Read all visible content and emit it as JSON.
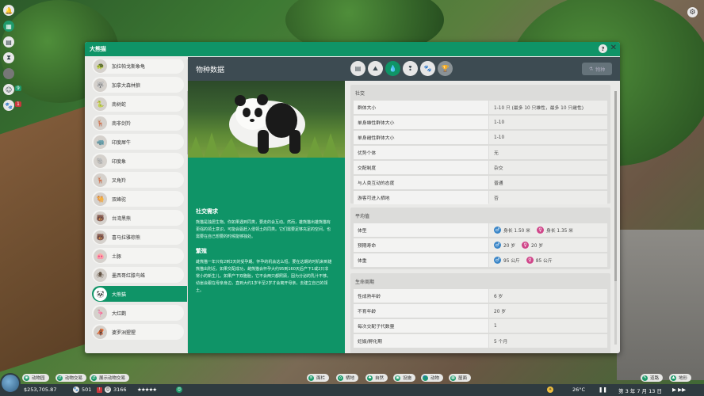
{
  "left_icons": [
    {
      "icon": "notification-icon",
      "count": ""
    },
    {
      "icon": "calendar-icon",
      "count": ""
    },
    {
      "icon": "grid-icon",
      "count": ""
    },
    {
      "icon": "hourglass-icon",
      "count": ""
    },
    {
      "icon": "empty-icon",
      "count": ""
    },
    {
      "icon": "guest-icon",
      "count": "9"
    },
    {
      "icon": "paw-icon",
      "count": "1"
    }
  ],
  "window": {
    "title": "大熊猫",
    "help": "?",
    "close": "✕"
  },
  "sidebar": {
    "items": [
      {
        "label": "加拉帕戈斯象龟",
        "icon": "🐢"
      },
      {
        "label": "加拿大森林狼",
        "icon": "🐺"
      },
      {
        "label": "南树蛇",
        "icon": "🐍"
      },
      {
        "label": "南非剑羚",
        "icon": "🦌"
      },
      {
        "label": "印度犀牛",
        "icon": "🦏"
      },
      {
        "label": "印度象",
        "icon": "🐘"
      },
      {
        "label": "叉角羚",
        "icon": "🦌"
      },
      {
        "label": "双峰驼",
        "icon": "🐫"
      },
      {
        "label": "台湾黑熊",
        "icon": "🐻"
      },
      {
        "label": "喜马拉雅棕熊",
        "icon": "🐻"
      },
      {
        "label": "土豚",
        "icon": "🐽"
      },
      {
        "label": "墨西哥红膝鸟蛛",
        "icon": "🕷"
      },
      {
        "label": "大熊猫",
        "icon": "🐼",
        "selected": true
      },
      {
        "label": "大红鹳",
        "icon": "🦩"
      },
      {
        "label": "婆罗洲猩猩",
        "icon": "🦧"
      }
    ]
  },
  "header": {
    "title": "物种数据",
    "tabs": [
      {
        "icon": "document-icon",
        "glyph": "▤"
      },
      {
        "icon": "terrain-icon",
        "glyph": "⛰"
      },
      {
        "icon": "water-drop-icon",
        "glyph": "💧",
        "active": true
      },
      {
        "icon": "social-icon",
        "glyph": "❢"
      },
      {
        "icon": "paw-icon",
        "glyph": "🐾"
      },
      {
        "icon": "trophy-icon",
        "glyph": "🏆",
        "dim": true
      }
    ],
    "right_button": "物种"
  },
  "description": {
    "social_heading": "社交需求",
    "social_text": "熊猫是独居生物。你如果遇到同类，要走的会互动。然而，雄熊猫出雄熊猫有更强的领土意识，可能会驱赶入侵领土的同类。它们需要足够充足的空间，也需要在自己想要的时候能够独处。",
    "breeding_heading": "繁殖",
    "breeding_text": "雌熊猫一年只有2到3天的受孕期。怀孕的机会这么短，要在这期的时机来到雄熊猫出附近。如果交配成功，雌熊猫会怀孕大约95到160天后产下1或2只非常小的新生儿。如果产下双胞胎，它不会两只都照顾，因为分泌的乳汁不够。幼崽会跟在母亲身边，直到大约1岁半至2岁才会离开母亲，去建立自己的领土。"
  },
  "social": {
    "title": "社交",
    "rows": [
      {
        "k": "群体大小",
        "v": "1-10 只 (最多 10 只雄性，最多 10 只雌性)"
      },
      {
        "k": "单身雄性群体大小",
        "v": "1-10"
      },
      {
        "k": "单身雌性群体大小",
        "v": "1-10"
      },
      {
        "k": "优势个体",
        "v": "无"
      },
      {
        "k": "交配制度",
        "v": "杂交"
      },
      {
        "k": "与人类互动的态度",
        "v": "普通"
      },
      {
        "k": "游客可进入栖地",
        "v": "否"
      }
    ]
  },
  "average": {
    "title": "平均值",
    "rows": [
      {
        "k": "体型",
        "male": "身长 1.50 米",
        "female": "身长 1.35 米"
      },
      {
        "k": "预期寿命",
        "male": "20 岁",
        "female": "20 岁"
      },
      {
        "k": "体重",
        "male": "95 公斤",
        "female": "85 公斤"
      }
    ]
  },
  "lifecycle": {
    "title": "生命周期",
    "rows": [
      {
        "k": "性成熟年龄",
        "v": "6 岁"
      },
      {
        "k": "不育年龄",
        "v": "20 岁"
      },
      {
        "k": "每次交配子代数量",
        "v": "1"
      },
      {
        "k": "妊娠/孵化期",
        "v": "5 个月"
      }
    ]
  },
  "topbar": {
    "left": [
      "动物园",
      "动物交易",
      "展示动物交易"
    ],
    "right": [
      "面栏",
      "栖地",
      "自然",
      "设施",
      "动物",
      "屋面"
    ],
    "far_right": [
      "道路",
      "地形"
    ]
  },
  "bottombar": {
    "money": "$253,705.87",
    "animals": "501",
    "guests": "3166",
    "stars": "★★★★★",
    "temperature": "26°C",
    "date": "第 3 年 7 月 13 日"
  },
  "colors": {
    "accent": "#0f9467",
    "header": "#3d4b52",
    "male": "#3a86c8",
    "female": "#d0468a"
  }
}
